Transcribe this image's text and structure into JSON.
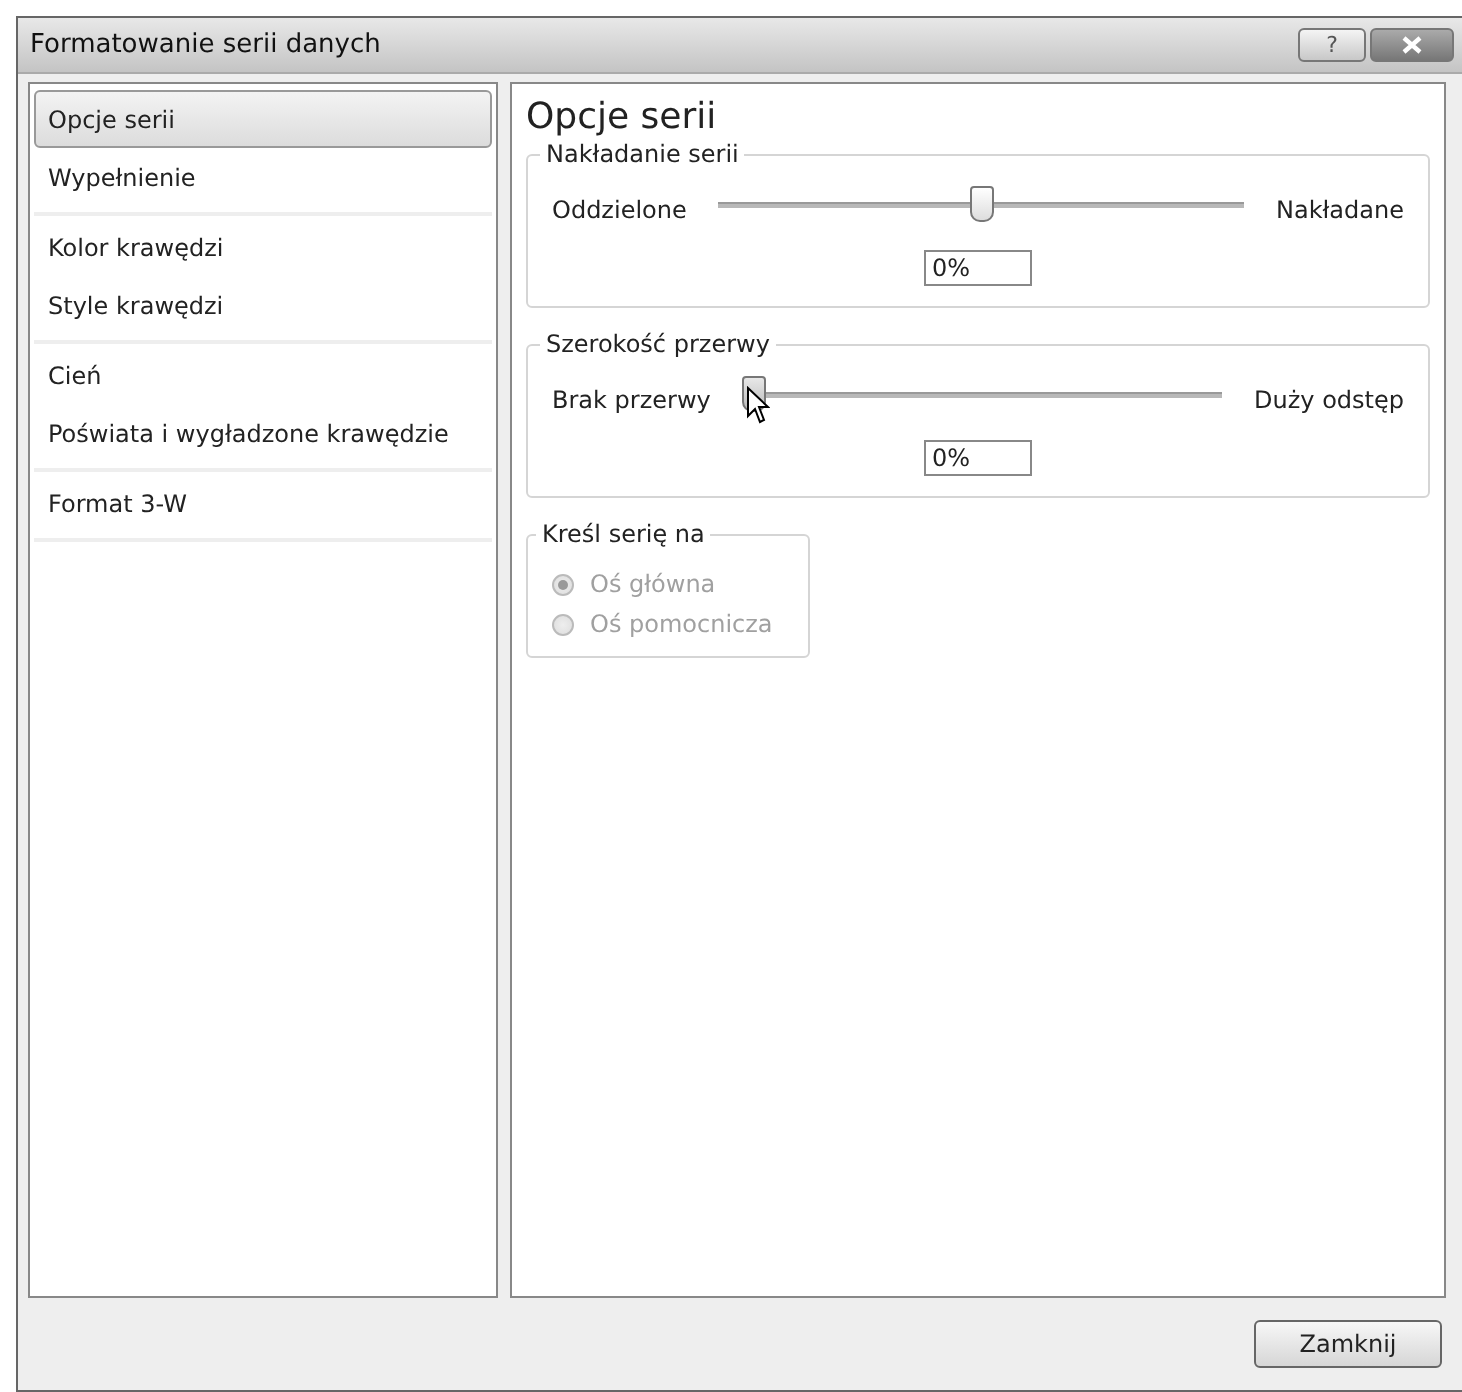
{
  "window": {
    "title": "Formatowanie serii danych",
    "buttons": [
      "?"
    ]
  },
  "sidebar": {
    "groups": [
      {
        "items": [
          {
            "label": "Opcje serii",
            "selected": true
          },
          {
            "label": "Wypełnienie",
            "selected": false
          }
        ]
      },
      {
        "items": [
          {
            "label": "Kolor krawędzi",
            "selected": false
          },
          {
            "label": "Style krawędzi",
            "selected": false
          }
        ]
      },
      {
        "items": [
          {
            "label": "Cień",
            "selected": false
          },
          {
            "label": "Poświata i wygładzone krawędzie",
            "selected": false
          }
        ]
      },
      {
        "items": [
          {
            "label": "Format 3-W",
            "selected": false
          }
        ]
      }
    ]
  },
  "panel": {
    "title": "Opcje serii",
    "sliders": [
      {
        "group": "Nakładanie serii",
        "left": "Oddzielone",
        "right": "Nakładane",
        "level": 0.5,
        "value": "0%",
        "hovered": false
      },
      {
        "group": "Szerokość przerwy",
        "left": "Brak przerwy",
        "right": "Duży odstęp",
        "level": 0,
        "value": "0%",
        "hovered": true
      }
    ],
    "plot_on": {
      "group": "Kreśl serię na",
      "disabled": true,
      "options": [
        {
          "label": "Oś główna",
          "selected": true
        },
        {
          "label": "Oś pomocnicza",
          "selected": false
        }
      ]
    }
  },
  "footer": {
    "button": "Zamknij"
  }
}
